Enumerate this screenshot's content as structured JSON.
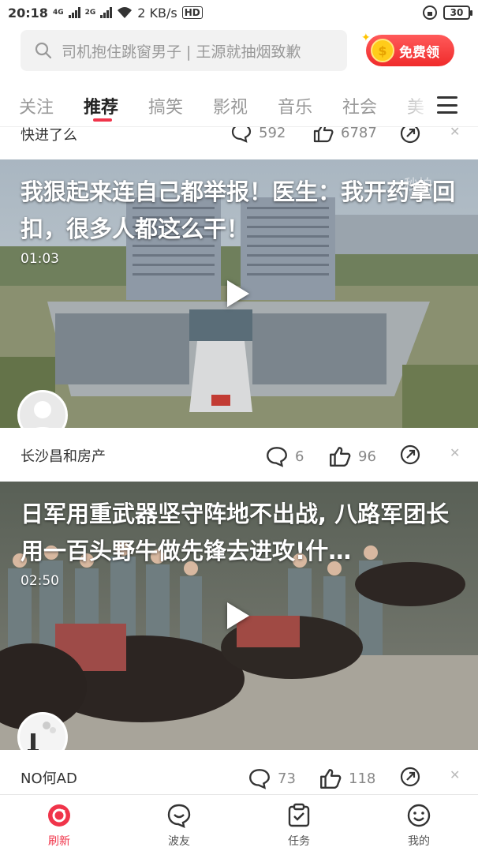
{
  "status_bar": {
    "time": "20:18",
    "net1": "4G",
    "net2": "2G",
    "speed": "2 KB/s",
    "hd": "HD",
    "battery": "30"
  },
  "search": {
    "placeholder": "司机抱住跳窗男子 | 王源就抽烟致歉"
  },
  "promo": {
    "label": "免费领",
    "coin": "$"
  },
  "tabs": [
    "关注",
    "推荐",
    "搞笑",
    "影视",
    "音乐",
    "社会",
    "美"
  ],
  "active_tab": "推荐",
  "partial_item": {
    "author": "快进了么",
    "comments": "592",
    "likes": "6787"
  },
  "feed": [
    {
      "title": "我狠起来连自己都举报！医生：我开药拿回扣，很多人都这么干！",
      "duration": "01:03",
      "watermark": "秒拍",
      "author": "长沙昌和房产",
      "comments": "6",
      "likes": "96"
    },
    {
      "title": "日军用重武器坚守阵地不出战, 八路军团长用一百头野牛做先锋去进攻!什…",
      "duration": "02:50",
      "author": "NO何AD",
      "comments": "73",
      "likes": "118"
    }
  ],
  "bottom_nav": [
    {
      "label": "刷新",
      "icon": "refresh-icon"
    },
    {
      "label": "波友",
      "icon": "smile-chat-icon"
    },
    {
      "label": "任务",
      "icon": "task-icon"
    },
    {
      "label": "我的",
      "icon": "profile-smile-icon"
    }
  ],
  "colors": {
    "accent": "#f0344a",
    "promo": "#f02b2b",
    "coin": "#ffcc1a"
  }
}
